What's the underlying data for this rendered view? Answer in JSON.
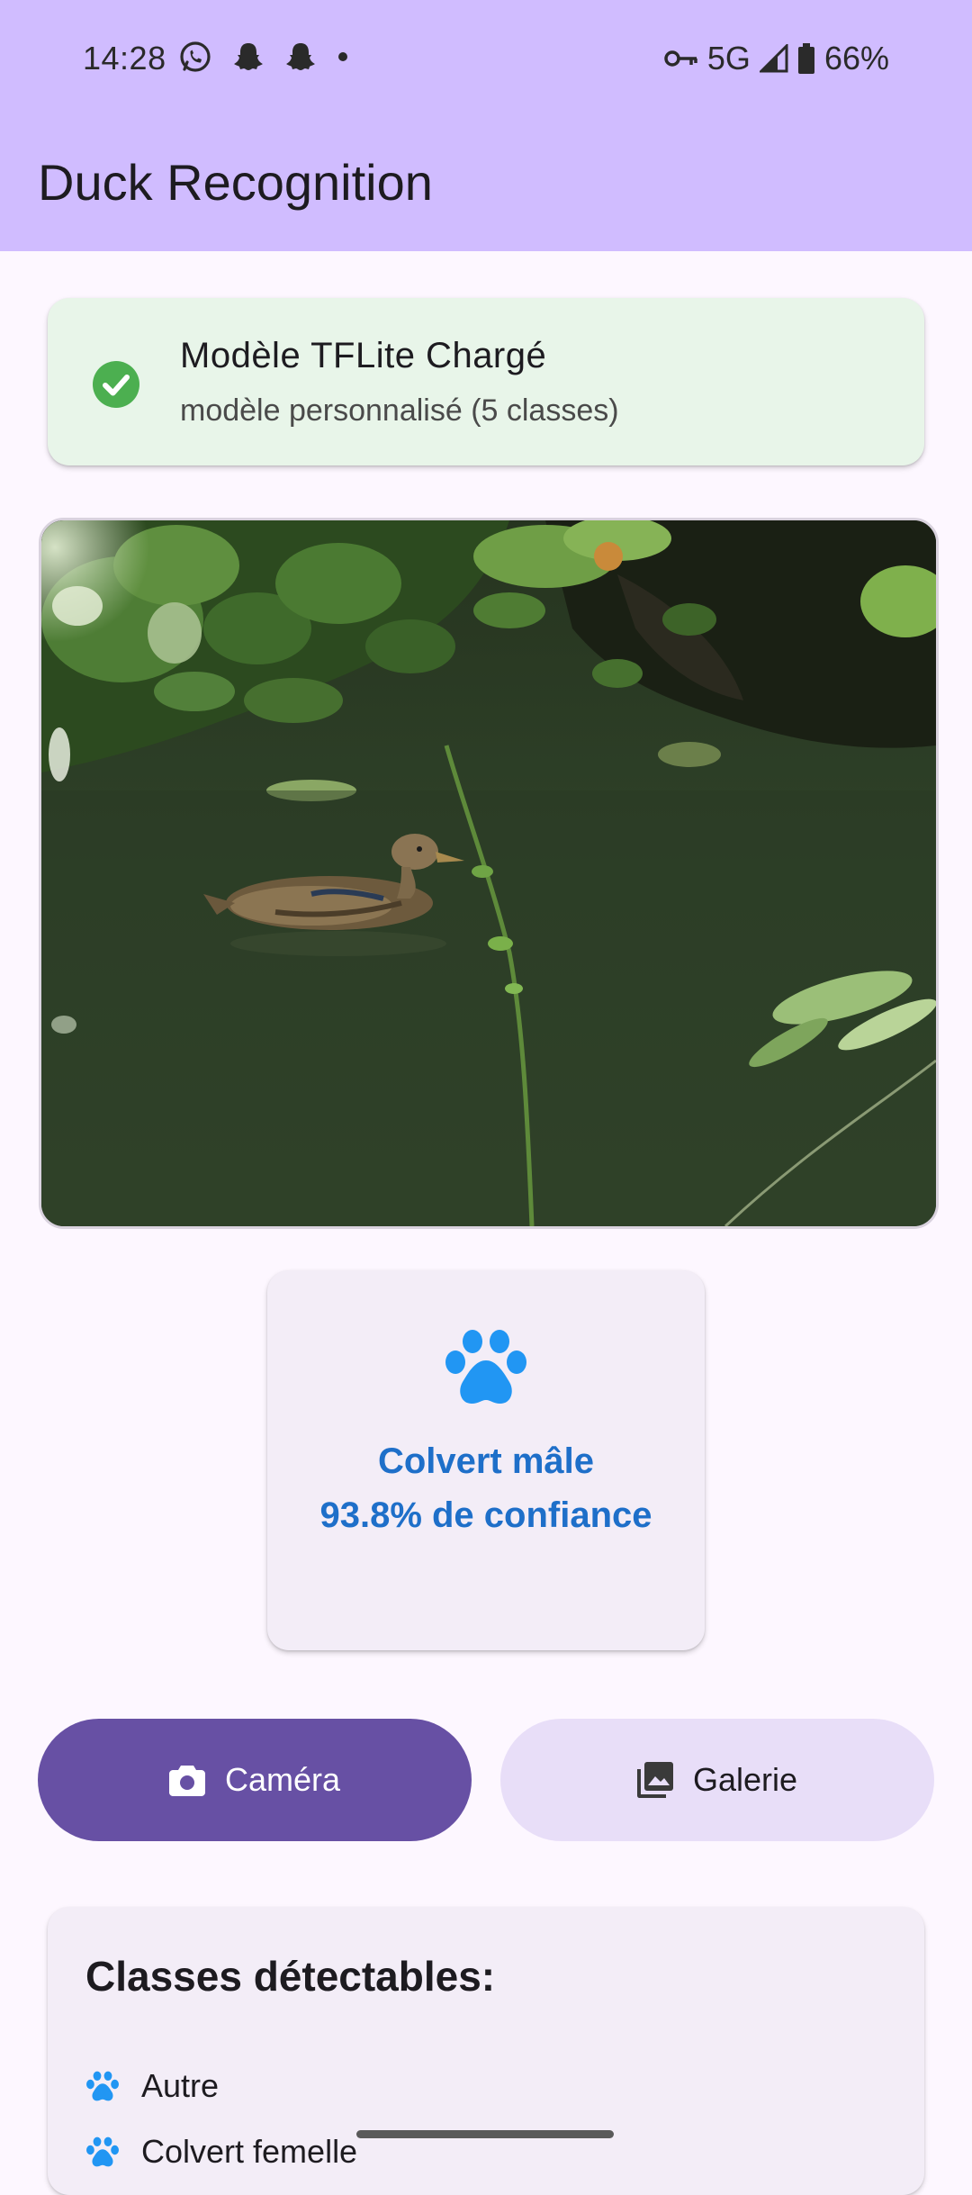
{
  "status_bar": {
    "time": "14:28",
    "network": "5G",
    "battery": "66%",
    "left_icons": [
      "whatsapp-icon",
      "snapchat-icon",
      "snapchat-icon",
      "dot-icon"
    ],
    "right_icons": [
      "key-icon",
      "signal-icon",
      "battery-icon"
    ]
  },
  "app_bar": {
    "title": "Duck Recognition"
  },
  "model_status": {
    "title": "Modèle TFLite Chargé",
    "subtitle": "modèle personnalisé (5 classes)",
    "icon": "check-circle-icon",
    "accent_color": "#4caf50"
  },
  "photo": {
    "icon": "duck-photo"
  },
  "result": {
    "icon": "paw-icon",
    "label": "Colvert mâle",
    "confidence_text": "93.8% de confiance",
    "color": "#1e6fc9"
  },
  "actions": {
    "camera_label": "Caméra",
    "gallery_label": "Galerie",
    "camera_icon": "camera-icon",
    "gallery_icon": "photo-library-icon"
  },
  "classes": {
    "title": "Classes détectables:",
    "items": [
      {
        "label": "Autre",
        "icon": "paw-icon"
      },
      {
        "label": "Colvert femelle",
        "icon": "paw-icon"
      }
    ]
  },
  "colors": {
    "app_bar": "#d0bcff",
    "primary": "#6750a4",
    "secondary_container": "#e8def8",
    "background": "#fdf7ff"
  }
}
